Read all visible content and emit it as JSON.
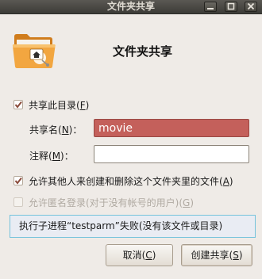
{
  "window": {
    "title": "文件夹共享"
  },
  "header": {
    "title": "文件夹共享"
  },
  "share_checkbox": {
    "label": "共享此目录(",
    "key": "F",
    "close": ")",
    "checked": true
  },
  "share_name": {
    "label": "共享名(",
    "key": "N",
    "close": ")：",
    "value": "movie"
  },
  "comment": {
    "label": "注释(",
    "key": "M",
    "close": ")：",
    "value": ""
  },
  "allow_write": {
    "label": "允许其他人来创建和删除这个文件夹里的文件(",
    "key": "A",
    "close": ")",
    "checked": true
  },
  "guest_access": {
    "label": "允许匿名登录(对于没有帐号的用户)(",
    "key": "G",
    "close": ")",
    "checked": false,
    "enabled": false
  },
  "info": {
    "message": "执行子进程“testparm”失败(没有该文件或目录)"
  },
  "buttons": {
    "cancel": {
      "label": "取消(",
      "key": "C",
      "close": ")"
    },
    "create": {
      "label": "创建共享(",
      "key": "S",
      "close": ")"
    }
  },
  "icons": {
    "folder": "folder-share-icon",
    "minimize": "minimize-icon",
    "maximize": "maximize-icon",
    "close": "close-icon",
    "check": "checkmark-icon"
  },
  "colors": {
    "titlebar": "#3c3b37",
    "window_bg": "#efebe7",
    "error_field": "#c4605b",
    "info_border": "#76c3dc",
    "checkmark": "#8a4a3a"
  }
}
